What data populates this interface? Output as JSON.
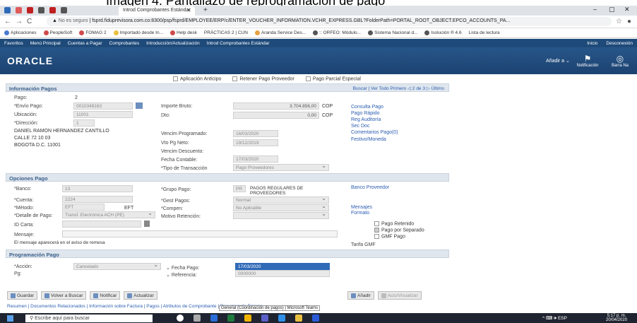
{
  "caption": "Imagen 4. Pantallazo de reprogramación de pago",
  "browser": {
    "tab_title": "Introd Comprobantes Estándar",
    "address_security": "No es seguro",
    "url": "fsprd.fiduprevisora.com.co:8300/psp/fsprd/EMPLOYEE/ERP/c/ENTER_VOUCHER_INFORMATION.VCHR_EXPRESS.GBL?FolderPath=PORTAL_ROOT_OBJECT.EPCO_ACCOUNTS_PA...",
    "bookmarks": [
      "Aplicaciones",
      "PeopleSoft",
      "FOMAG 2",
      "Importado desde In...",
      "Help desk",
      "PRÁCTICAS 2 | CUN",
      "Aranda Service Des...",
      ":: ORFEO: Módulo...",
      "Sistema Nacional d...",
      "Isolución ® 4.6",
      "Lista de lectura"
    ]
  },
  "psnav": {
    "items": [
      "Favoritos",
      "Menú Principal",
      "Cuentas a Pagar",
      "Comprobantes",
      "Introducción/Actualización",
      "Introd Comprobantes Estándar"
    ],
    "right": [
      "Inicio",
      "Desconexión"
    ]
  },
  "oracle": {
    "logo": "ORACLE",
    "add": "Añadir a",
    "notif": "Notificación",
    "barra": "Barra Na"
  },
  "checkboxes": [
    "Aplicación Anticipo",
    "Retener Pago Proveedor",
    "Pago Parcial Especial"
  ],
  "info_pagos": {
    "title": "Información Pagos",
    "links": "Buscar | Ver Todo     Primero  ◁  2 de 3  ▷  Último",
    "pago_label": "Pago:",
    "pago_value": "2",
    "envio_label": "*Envío Pago:",
    "envio_value": "0010348163",
    "ubicacion_label": "Ubicación:",
    "ubicacion_value": "11001",
    "direccion_label": "*Dirección:",
    "direccion_value": "1",
    "addr_lines": [
      "DANIEL RAMON HERNANDEZ CANTILLO",
      "CALLE 72 10 03",
      "BOGOTA D.C.  11001"
    ],
    "importe_label": "Importe Bruto:",
    "importe_value": "3.704.856,00",
    "importe_cur": "COP",
    "dto_label": "Dto:",
    "dto_value": "0,00",
    "dto_cur": "COP",
    "vencim_prog_label": "Vencim Programado:",
    "vencim_prog_value": "16/03/2020",
    "vto_neto_label": "Vto Pg Neto:",
    "vto_neto_value": "19/12/2019",
    "vencim_desc_label": "Vencim Descuento:",
    "fecha_cont_label": "Fecha Contable:",
    "fecha_cont_value": "17/03/2020",
    "tipo_trans_label": "*Tipo de Transacción",
    "tipo_trans_value": "Pago Proveedores",
    "right_links": [
      "Consulta Pago",
      "Pago Rápido",
      "Reg Auditoría",
      "Sec Doc",
      "Comentarios Pago(0)",
      "Festivo/Moneda"
    ]
  },
  "opciones_pago": {
    "title": "Opciones Pago",
    "banco_label": "*Banco:",
    "banco_value": "13",
    "cuenta_label": "*Cuenta:",
    "cuenta_value": "2224",
    "metodo_label": "*Método:",
    "metodo_value": "EFT",
    "metodo_text": "EFT",
    "detalle_label": "*Detalle de Pago:",
    "detalle_value": "Transf. Electrónica ACH (PE)",
    "idcarta_label": "ID Carta:",
    "mensaje_label": "Mensaje:",
    "nota": "El mensaje aparecerá en el aviso de remesa",
    "grupo_label": "*Grupo Pago:",
    "grupo_value": "PR",
    "grupo_desc": "PAGOS REGULARES DE PROVEEDORES",
    "gest_label": "*Gest Pagos:",
    "gest_value": "Normal",
    "compen_label": "*Compen:",
    "compen_value": "No Aplicable",
    "motivo_label": "Motivo Retención:",
    "banco_link": "Banco Proveedor",
    "mensajes_link": "Mensajes",
    "formato_link": "Formato",
    "chk_retenido": "Pago Retenido",
    "chk_separado": "Pago por Separado",
    "chk_gmf": "GMF Pago",
    "tarifa": "Tarifa GMF"
  },
  "programacion": {
    "title": "Programación Pago",
    "accion_label": "*Acción:",
    "accion_value": "Cancelado",
    "pg_label": "Pg:",
    "fecha_label": "Fecha Pago:",
    "fecha_value": "17/03/2020",
    "ref_label": "Referencia:",
    "ref_value": "0000000"
  },
  "buttons": [
    "Guardar",
    "Volver a Buscar",
    "Notificar",
    "Actualizar"
  ],
  "buttons_right": [
    "Añadir",
    "Actu/Visualizar"
  ],
  "footer": "Resumen | Documentos Relacionados | Información sobre Factura | Pagos | Atributos de Comprobante | Resumen de Errores",
  "tooltip": "General (Coordinación de pagos) | Microsoft Teams",
  "taskbar": {
    "search": "Escribe aquí para buscar",
    "tray": "^  ⌨ 🕪 ESP",
    "time": "5:17 p. m.",
    "date": "20/04/2020"
  },
  "colors": {
    "nav": "#1e4a7a",
    "header": "#275689",
    "link": "#2a5db0",
    "section": "#dfe6ee"
  }
}
